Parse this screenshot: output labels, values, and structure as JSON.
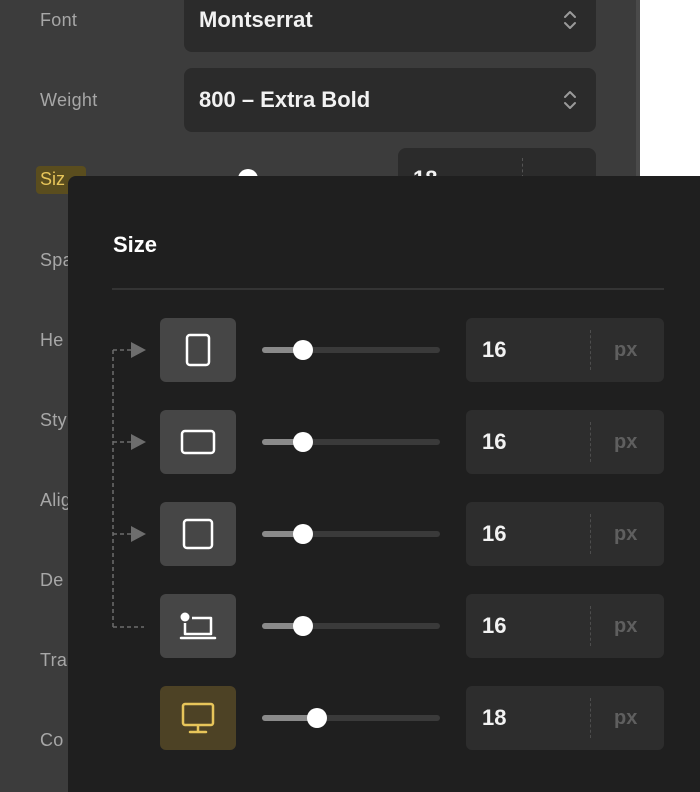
{
  "background_panel": {
    "rows": [
      {
        "label": "Font",
        "value": "Montserrat"
      },
      {
        "label": "Weight",
        "value": "800 – Extra Bold"
      }
    ],
    "size_label": "Siz",
    "size_value_partial": "18",
    "cut_labels": [
      "Spa",
      "He",
      "Sty",
      "Alig",
      "De",
      "Tra",
      "Co"
    ]
  },
  "popover": {
    "title": "Size",
    "rows": [
      {
        "device": "phone-portrait",
        "icon": "phone-portrait-icon",
        "value": "16",
        "unit": "px",
        "slider_fraction": 0.23,
        "active": false
      },
      {
        "device": "phone-landscape",
        "icon": "phone-landscape-icon",
        "value": "16",
        "unit": "px",
        "slider_fraction": 0.23,
        "active": false
      },
      {
        "device": "tablet",
        "icon": "tablet-icon",
        "value": "16",
        "unit": "px",
        "slider_fraction": 0.23,
        "active": false
      },
      {
        "device": "laptop",
        "icon": "laptop-base-icon",
        "value": "16",
        "unit": "px",
        "slider_fraction": 0.23,
        "active": false
      },
      {
        "device": "desktop",
        "icon": "desktop-icon",
        "value": "18",
        "unit": "px",
        "slider_fraction": 0.31,
        "active": true
      }
    ]
  },
  "colors": {
    "accent": "#e7c55a",
    "active_bg": "#4d4225",
    "popover_bg": "#1f1f1f"
  }
}
